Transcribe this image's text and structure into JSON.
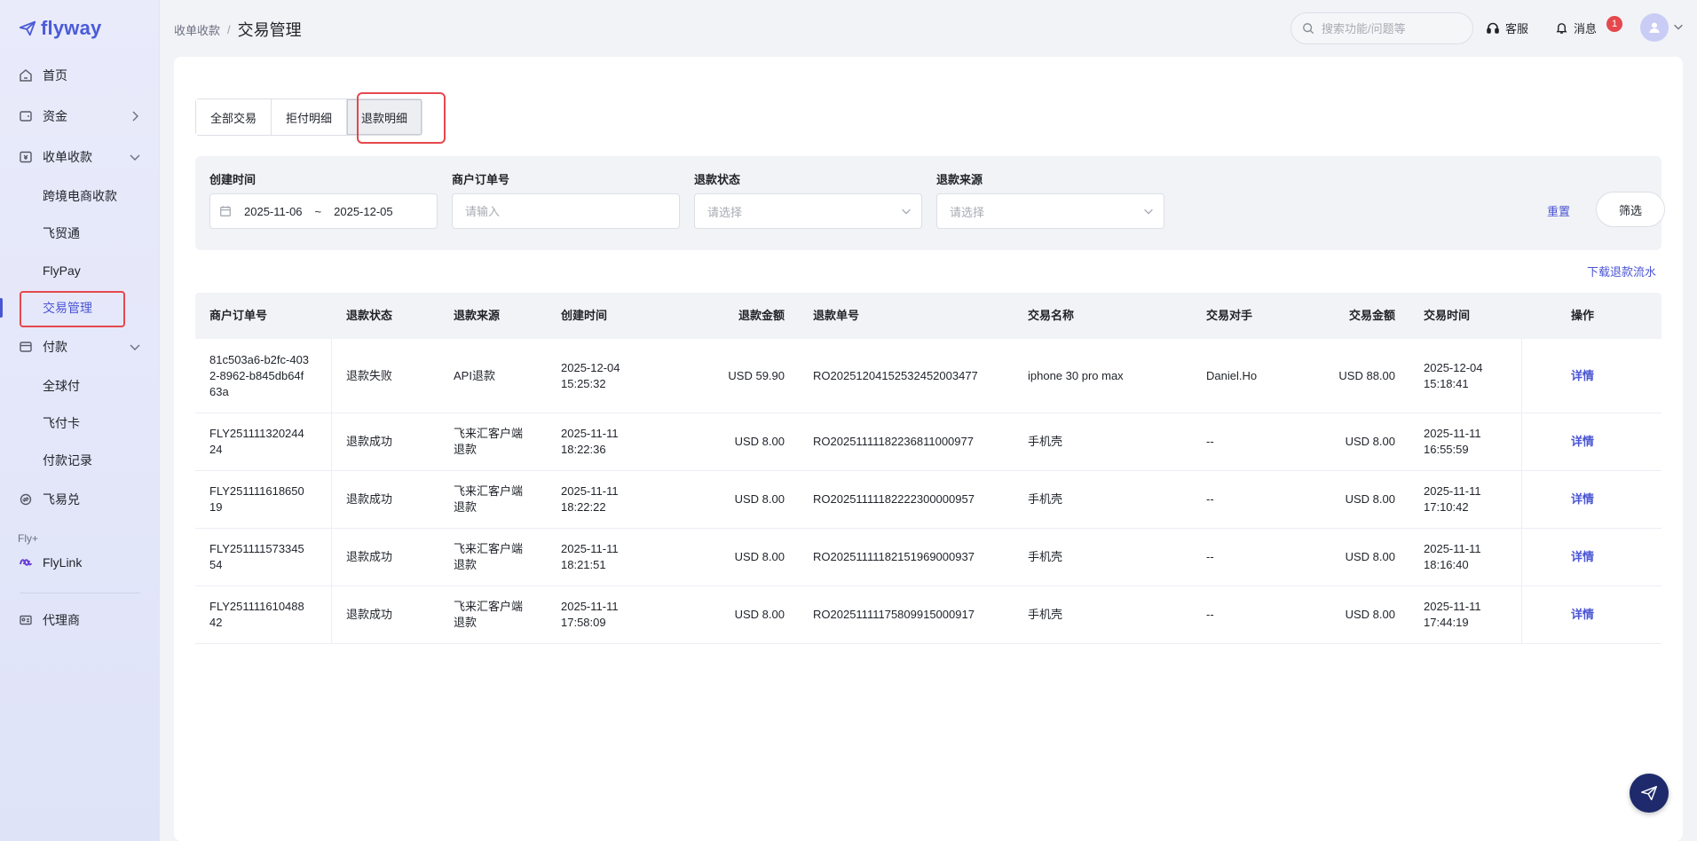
{
  "app": {
    "logo_text": "flyway"
  },
  "sidebar": {
    "items": [
      {
        "label": "首页",
        "icon": "home-icon"
      },
      {
        "label": "资金",
        "icon": "wallet-icon"
      },
      {
        "label": "收单收款",
        "icon": "receipt-icon"
      },
      {
        "label": "付款",
        "icon": "payment-icon"
      },
      {
        "label": "飞易兑",
        "icon": "exchange-icon"
      }
    ],
    "collect_sub": [
      "跨境电商收款",
      "飞贸通",
      "FlyPay",
      "交易管理"
    ],
    "pay_sub": [
      "全球付",
      "飞付卡",
      "付款记录"
    ],
    "fly_plus_label": "Fly+",
    "flylink_label": "FlyLink",
    "agent_label": "代理商",
    "active_item": "交易管理"
  },
  "header": {
    "breadcrumb_parent": "收单收款",
    "breadcrumb_sep": "/",
    "title": "交易管理",
    "search_placeholder": "搜索功能/问题等",
    "service_label": "客服",
    "message_label": "消息",
    "message_count": "1"
  },
  "tabs": [
    "全部交易",
    "拒付明细",
    "退款明细"
  ],
  "active_tab": "退款明细",
  "filters": {
    "created_label": "创建时间",
    "date_start": "2025-11-06",
    "date_sep": "~",
    "date_end": "2025-12-05",
    "order_label": "商户订单号",
    "order_placeholder": "请输入",
    "status_label": "退款状态",
    "status_placeholder": "请选择",
    "source_label": "退款来源",
    "source_placeholder": "请选择",
    "reset_label": "重置",
    "filter_label": "筛选"
  },
  "download_label": "下载退款流水",
  "table": {
    "headers": [
      "商户订单号",
      "退款状态",
      "退款来源",
      "创建时间",
      "退款金额",
      "退款单号",
      "交易名称",
      "交易对手",
      "交易金额",
      "交易时间",
      "操作"
    ],
    "rows": [
      {
        "order_l1": "81c503a6-b2fc-403",
        "order_l2": "2-8962-b845db64f",
        "order_l3": "63a",
        "status": "退款失败",
        "source_l1": "API退款",
        "source_l2": "",
        "created_date": "2025-12-04",
        "created_time": "15:25:32",
        "refund_amount": "USD 59.90",
        "refund_no": "RO2025120415253245200347​7",
        "trade_name": "iphone 30 pro max",
        "counterparty": "Daniel.Ho",
        "trade_amount": "USD 88.00",
        "trade_date": "2025-12-04",
        "trade_time": "15:18:41",
        "action": "详情"
      },
      {
        "order_l1": "FLY251111320244",
        "order_l2": "24",
        "order_l3": "",
        "status": "退款成功",
        "source_l1": "飞来汇客户端",
        "source_l2": "退款",
        "created_date": "2025-11-11",
        "created_time": "18:22:36",
        "refund_amount": "USD 8.00",
        "refund_no": "RO2025111118223681100097​7",
        "trade_name": "手机壳",
        "counterparty": "--",
        "trade_amount": "USD 8.00",
        "trade_date": "2025-11-11",
        "trade_time": "16:55:59",
        "action": "详情"
      },
      {
        "order_l1": "FLY251111618650",
        "order_l2": "19",
        "order_l3": "",
        "status": "退款成功",
        "source_l1": "飞来汇客户端",
        "source_l2": "退款",
        "created_date": "2025-11-11",
        "created_time": "18:22:22",
        "refund_amount": "USD 8.00",
        "refund_no": "RO20251111182222300000957",
        "trade_name": "手机壳",
        "counterparty": "--",
        "trade_amount": "USD 8.00",
        "trade_date": "2025-11-11",
        "trade_time": "17:10:42",
        "action": "详情"
      },
      {
        "order_l1": "FLY251111573345",
        "order_l2": "54",
        "order_l3": "",
        "status": "退款成功",
        "source_l1": "飞来汇客户端",
        "source_l2": "退款",
        "created_date": "2025-11-11",
        "created_time": "18:21:51",
        "refund_amount": "USD 8.00",
        "refund_no": "RO20251111182151969000937",
        "trade_name": "手机壳",
        "counterparty": "--",
        "trade_amount": "USD 8.00",
        "trade_date": "2025-11-11",
        "trade_time": "18:16:40",
        "action": "详情"
      },
      {
        "order_l1": "FLY251111610488",
        "order_l2": "42",
        "order_l3": "",
        "status": "退款成功",
        "source_l1": "飞来汇客户端",
        "source_l2": "退款",
        "created_date": "2025-11-11",
        "created_time": "17:58:09",
        "refund_amount": "USD 8.00",
        "refund_no": "RO20251111175809915000917",
        "trade_name": "手机壳",
        "counterparty": "--",
        "trade_amount": "USD 8.00",
        "trade_date": "2025-11-11",
        "trade_time": "17:44:19",
        "action": "详情"
      }
    ]
  },
  "colors": {
    "accent": "#4a55d4",
    "highlight": "#e5484d",
    "sidebar_bg": "#e6e9fa",
    "page_bg": "#f2f3f7"
  }
}
